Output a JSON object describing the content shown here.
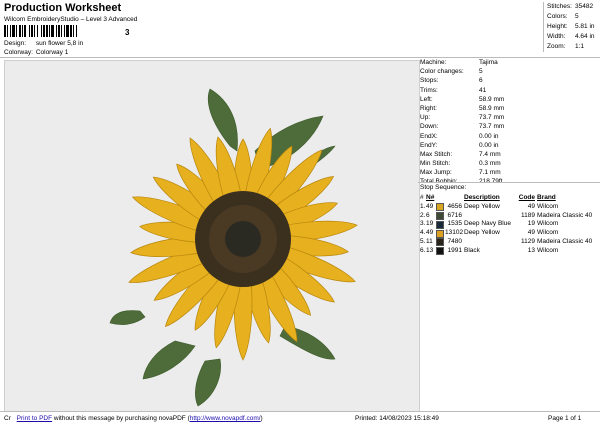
{
  "header": {
    "title": "Production Worksheet",
    "subtitle": "Wilcom EmbroideryStudio – Level 3 Advanced",
    "barcode_mark": "3"
  },
  "meta": {
    "design_label": "Design:",
    "design_value": "sun flower 5,8 in",
    "colorway_label": "Colorway:",
    "colorway_value": "Colorway 1"
  },
  "stats": [
    {
      "label": "Stitches:",
      "value": "35482"
    },
    {
      "label": "Colors:",
      "value": "5"
    },
    {
      "label": "Height:",
      "value": "5.81 in"
    },
    {
      "label": "Width:",
      "value": "4.64 in"
    },
    {
      "label": "Zoom:",
      "value": "1:1"
    }
  ],
  "info": [
    {
      "label": "Machine:",
      "value": "Tajima"
    },
    {
      "label": "Color changes:",
      "value": "5"
    },
    {
      "label": "Stops:",
      "value": "6"
    },
    {
      "label": "Trims:",
      "value": "41"
    },
    {
      "label": "Left:",
      "value": "58.9 mm"
    },
    {
      "label": "Right:",
      "value": "58.9 mm"
    },
    {
      "label": "Up:",
      "value": "73.7 mm"
    },
    {
      "label": "Down:",
      "value": "73.7 mm"
    },
    {
      "label": "EndX:",
      "value": "0.00 in"
    },
    {
      "label": "EndY:",
      "value": "0.00 in"
    },
    {
      "label": "Max Stitch:",
      "value": "7.4 mm"
    },
    {
      "label": "Min Stitch:",
      "value": "0.3 mm"
    },
    {
      "label": "Max Jump:",
      "value": "7.1 mm"
    },
    {
      "label": "Total Bobbin:",
      "value": "218.79ft"
    }
  ],
  "sequence": {
    "title": "Stop Sequence:",
    "headers": {
      "num": "N#",
      "code": "Code",
      "brand": "Brand"
    },
    "rows": [
      {
        "stop": "1.",
        "n": "49",
        "color": "#d9a521",
        "num": "4656",
        "desc": "Deep Yellow",
        "code": "49",
        "brand": "Wilcom"
      },
      {
        "stop": "2.",
        "n": "6",
        "color": "#3e4a34",
        "num": "6716",
        "desc": "",
        "code": "1189",
        "brand": "Madeira Classic 40"
      },
      {
        "stop": "3.",
        "n": "19",
        "color": "#1b2a3a",
        "num": "1535",
        "desc": "Deep Navy Blue",
        "code": "19",
        "brand": "Wilcom"
      },
      {
        "stop": "4.",
        "n": "49",
        "color": "#e0a020",
        "num": "13102",
        "desc": "Deep Yellow",
        "code": "49",
        "brand": "Wilcom"
      },
      {
        "stop": "5.",
        "n": "11",
        "color": "#2a2418",
        "num": "7480",
        "desc": "",
        "code": "1129",
        "brand": "Madeira Classic 40"
      },
      {
        "stop": "6.",
        "n": "13",
        "color": "#111111",
        "num": "1991",
        "desc": "Black",
        "code": "13",
        "brand": "Wilcom"
      }
    ]
  },
  "footer": {
    "cr": "Cr",
    "link_text": "Print to PDF",
    "message": " without this message by purchasing novaPDF (",
    "url_text": "http://www.novapdf.com/",
    "close": ")",
    "printed": "Printed:  14/08/2023 15:18:49",
    "page": "Page 1 of 1"
  },
  "colors": {
    "petal": "#e6b01f",
    "petal_dark": "#b8860b",
    "leaf": "#4e6b3a",
    "center": "#3b2f1e",
    "background": "#ececec"
  }
}
